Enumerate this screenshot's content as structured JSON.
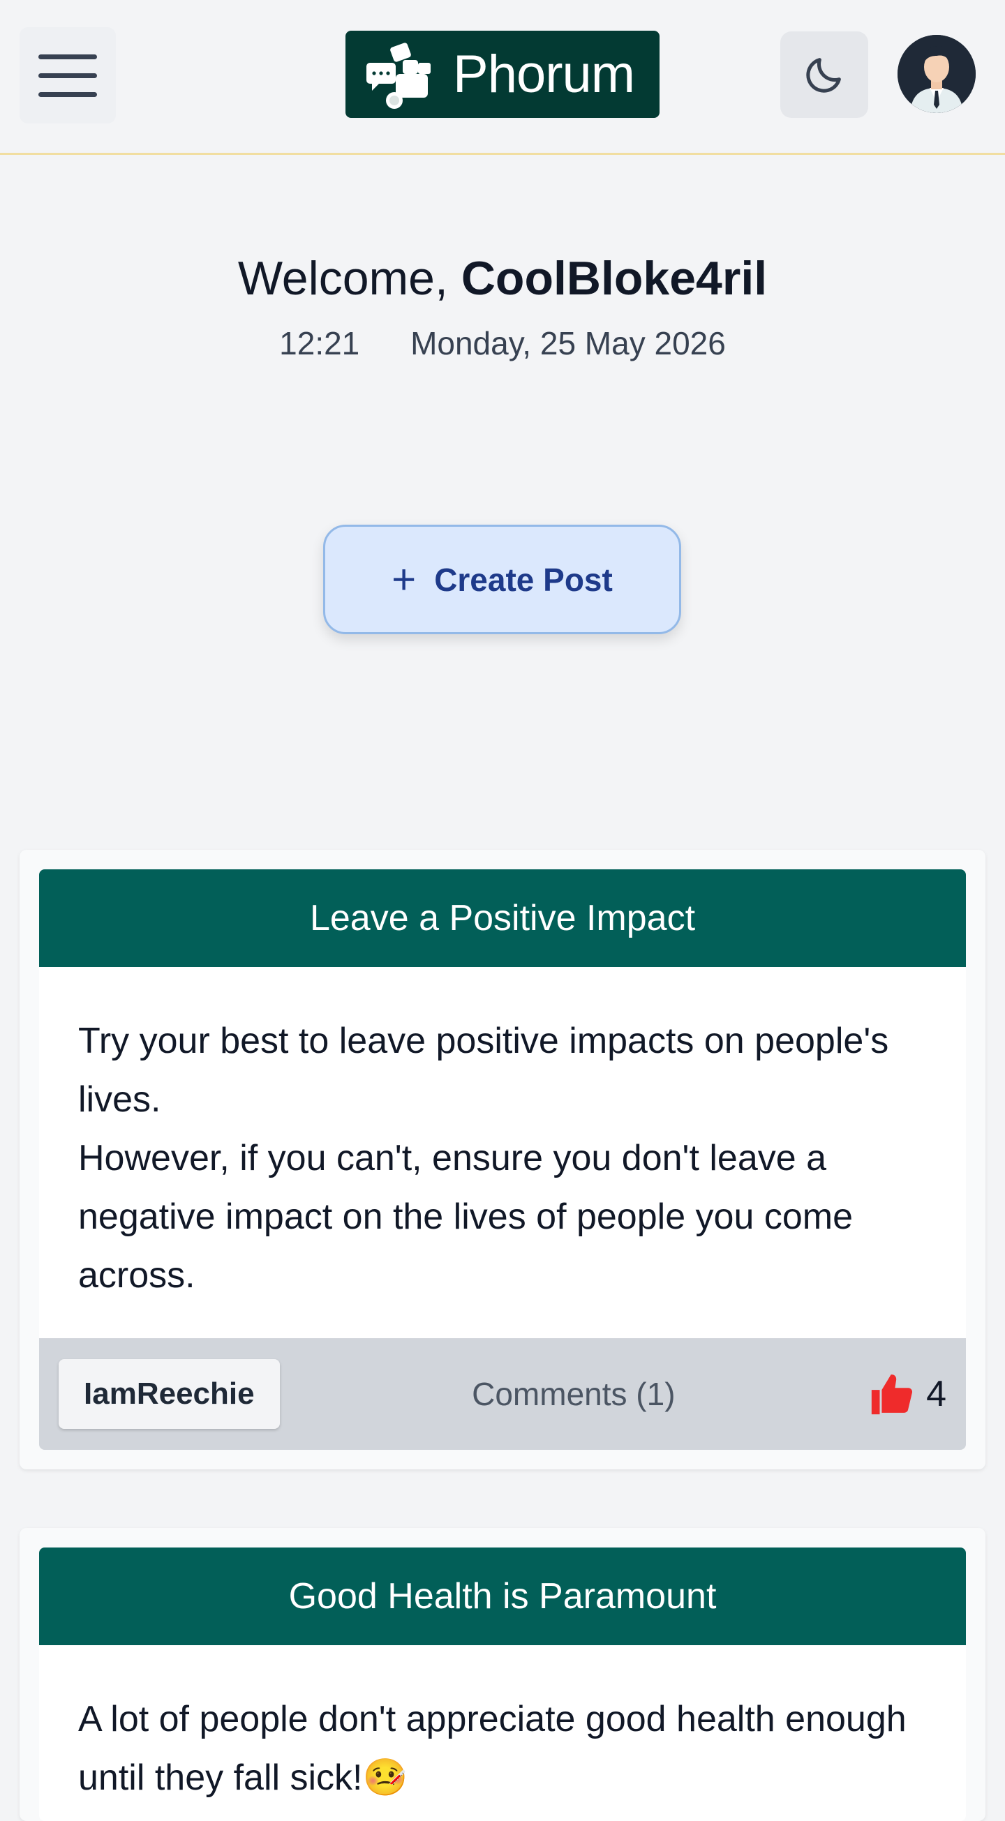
{
  "header": {
    "logo_text": "Phorum",
    "menu_icon": "hamburger-menu-icon",
    "theme_icon": "moon-icon",
    "avatar_icon": "user-avatar"
  },
  "welcome": {
    "greeting": "Welcome,",
    "username": "CoolBloke4ril",
    "time": "12:21",
    "date": "Monday, 25 May 2026"
  },
  "create_post": {
    "icon": "plus-icon",
    "label": "Create Post"
  },
  "posts": [
    {
      "title": "Leave a Positive Impact",
      "body_lines": [
        "Try your best to leave positive impacts on people's lives.",
        "However, if you can't, ensure you don't leave a negative impact on the lives of people you come across."
      ],
      "author": "IamReechie",
      "comments": "Comments (1)",
      "likes": "4",
      "like_color": "#ef2b2b"
    },
    {
      "title": "Good Health is Paramount",
      "body_lines": [
        "A lot of people don't appreciate good health enough until they fall sick!🤒"
      ]
    }
  ],
  "colors": {
    "background": "#f3f4f6",
    "logo_bg": "#033a33",
    "card_header": "#025f58",
    "create_button_bg": "#dbe8fd",
    "header_border": "#f1dea1"
  }
}
